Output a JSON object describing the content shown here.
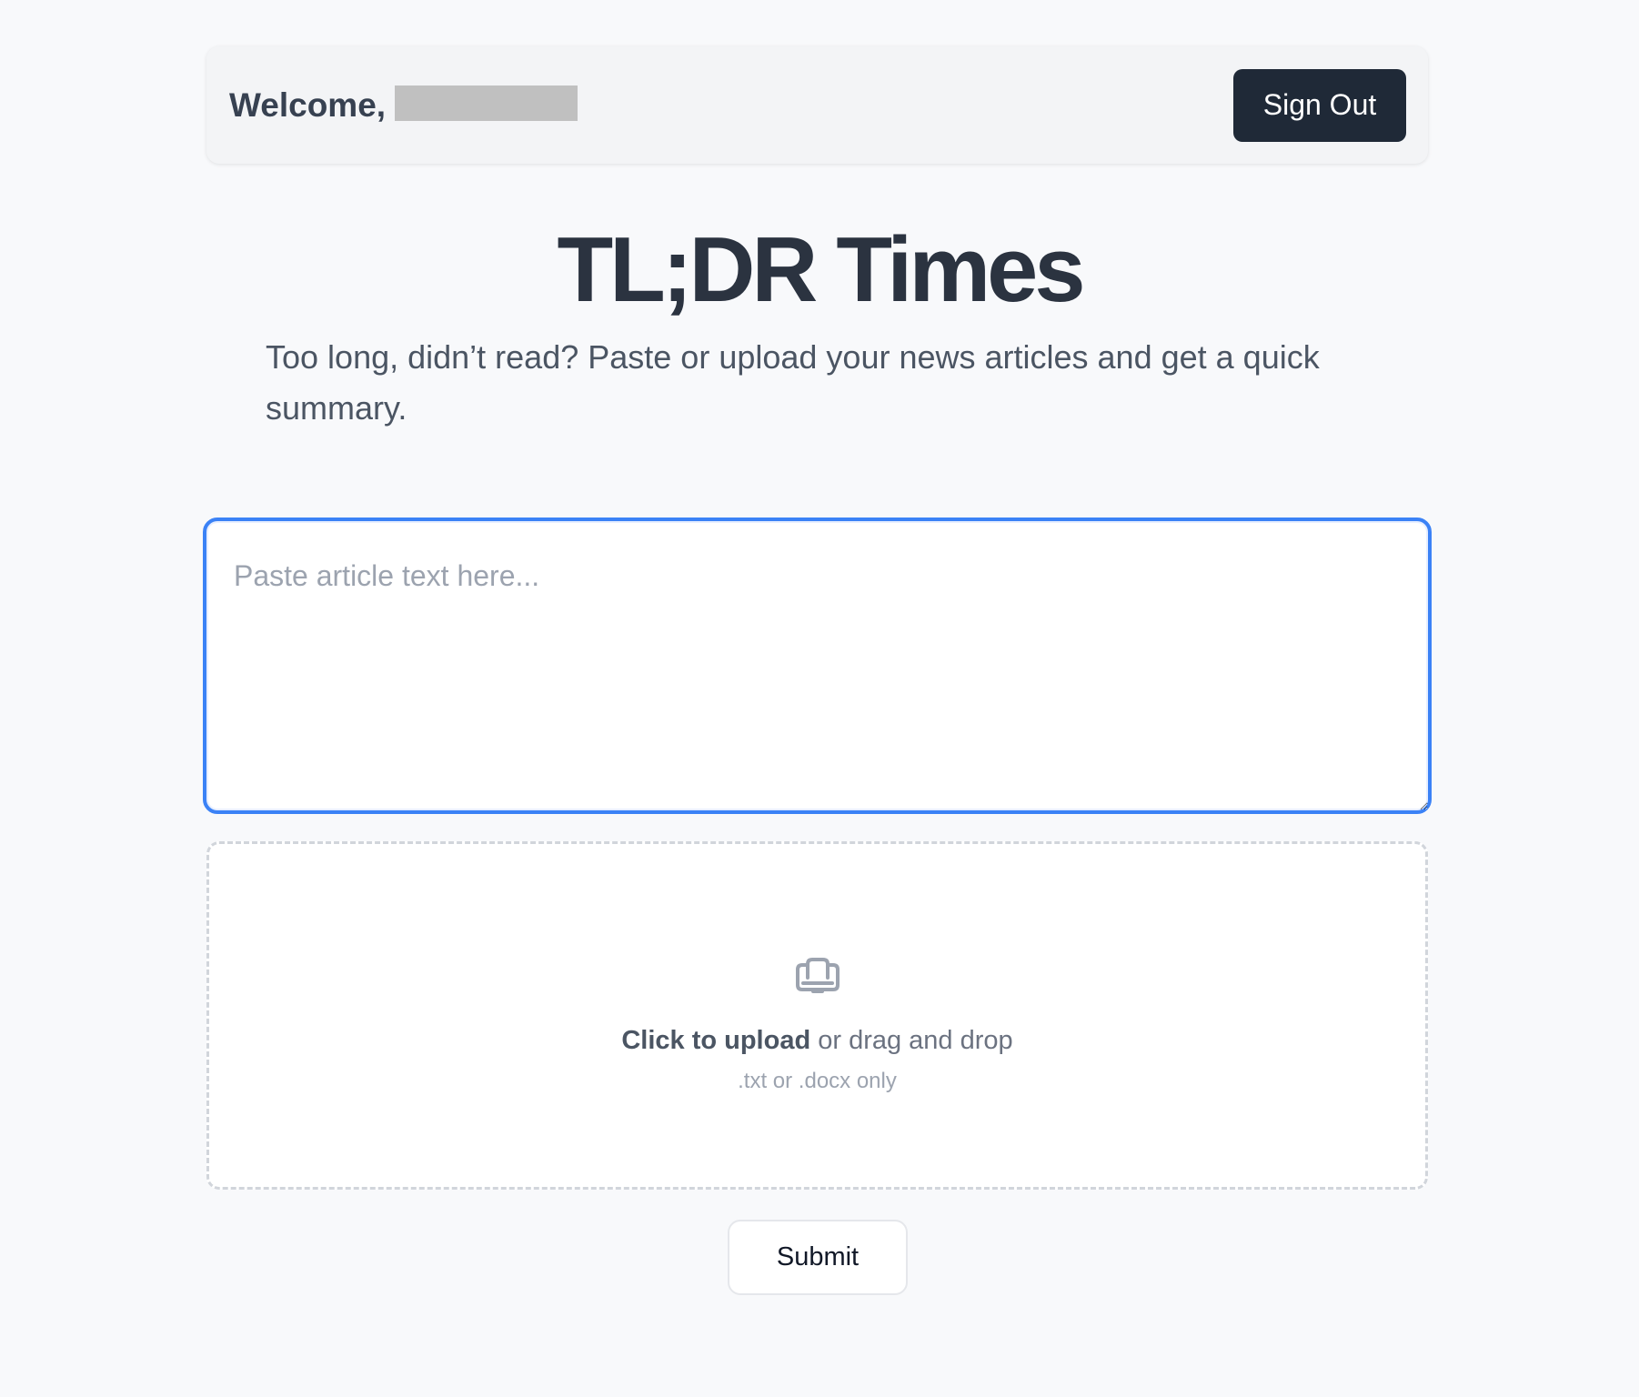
{
  "header": {
    "welcome_label": "Welcome,",
    "sign_out_label": "Sign Out"
  },
  "hero": {
    "title": "TL;DR Times",
    "tagline": "Too long, didn’t read? Paste or upload your news articles and get a quick summary."
  },
  "article_input": {
    "placeholder": "Paste article text here...",
    "value": ""
  },
  "upload": {
    "icon": "upload-icon",
    "action_label": "Click to upload",
    "action_suffix": " or drag and drop",
    "hint": ".txt or .docx only"
  },
  "submit_label": "Submit",
  "colors": {
    "background": "#f8f9fb",
    "header_bg": "#f3f4f6",
    "dark_button": "#1f2937",
    "focus_border": "#3b82f6",
    "muted_text": "#9ca3af"
  }
}
